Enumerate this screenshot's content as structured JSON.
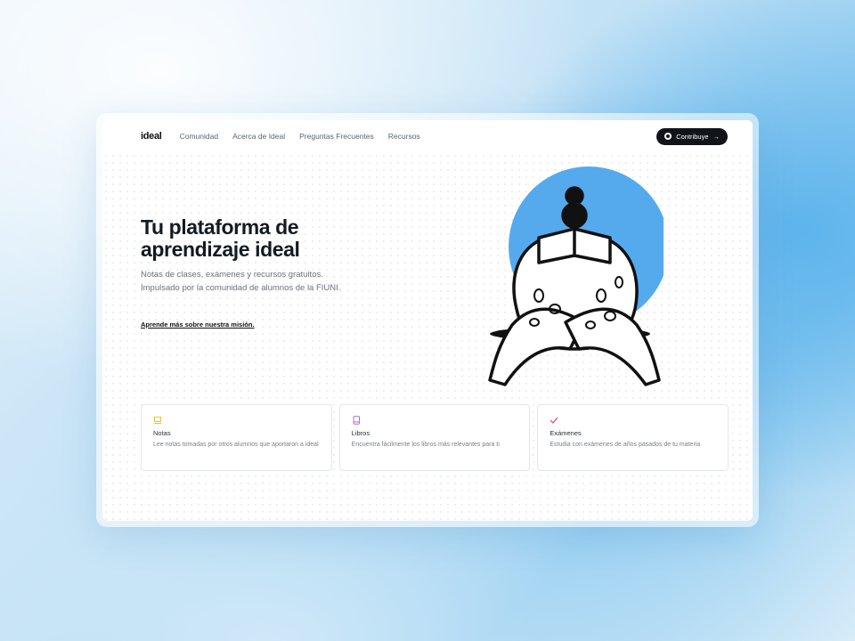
{
  "nav": {
    "logo": "ideal",
    "links": [
      "Comunidad",
      "Acerca de Ideal",
      "Preguntas Frecuentes",
      "Recursos"
    ],
    "contribute_label": "Contribuye",
    "contribute_icon": "github-icon",
    "contribute_arrow": "→"
  },
  "hero": {
    "title": "Tu plataforma de aprendizaje ideal",
    "subtitle": "Notas de clases, exámenes y recursos gratuitos. Impulsado por la comunidad de alumnos de la FIUNI.",
    "mission_link": "Aprende más sobre nuestra misión."
  },
  "illustration": {
    "circle_color": "#55aaee",
    "subject": "person-reading-book"
  },
  "cards": [
    {
      "icon": "laptop-icon",
      "icon_color": "#f0c419",
      "title": "Notas",
      "description": "Lee notas tomadas por otros alumnos que aportaron a ideal"
    },
    {
      "icon": "book-icon",
      "icon_color": "#b06ccf",
      "title": "Libros",
      "description": "Encuentra fácilmente los libros más relevantes para ti"
    },
    {
      "icon": "check-icon",
      "icon_color": "#e5485d",
      "title": "Exámenes",
      "description": "Estudia con exámenes de años pasados de tu materia"
    }
  ]
}
